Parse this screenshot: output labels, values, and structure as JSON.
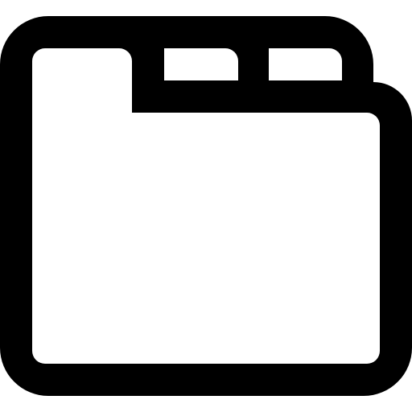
{
  "icon": {
    "name": "tabbed-folder-icon",
    "stroke_color": "#000000",
    "fill_color": "#ffffff",
    "tab_count": 3
  }
}
